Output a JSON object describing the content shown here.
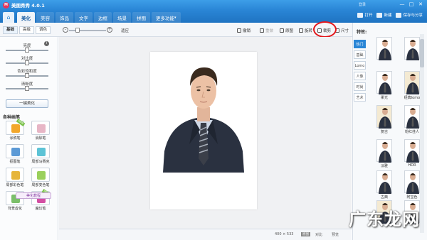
{
  "window": {
    "title": "美图秀秀 4.0.1",
    "login": "登录",
    "controls": [
      "—",
      "□",
      "✕"
    ]
  },
  "menu": {
    "tabs": [
      "美化",
      "美容",
      "饰品",
      "文字",
      "边框",
      "场景",
      "拼图",
      "更多功能"
    ],
    "active_index": 0,
    "right_actions": [
      "打开",
      "新建",
      "保存与分享"
    ]
  },
  "toolbar": {
    "subtabs": [
      "基础",
      "高级",
      "调色"
    ],
    "zoom_fit": "适应",
    "buttons": [
      "撤销",
      "重做",
      "原图",
      "旋转",
      "裁剪",
      "尺寸"
    ]
  },
  "left_panel": {
    "sliders": [
      {
        "label": "亮度",
        "value": 0.45
      },
      {
        "label": "对比度",
        "value": 0.45
      },
      {
        "label": "色彩饱和度",
        "value": 0.45
      },
      {
        "label": "清晰度",
        "value": 0.45
      }
    ],
    "one_key_button": "一键美化",
    "brushes_title": "各种画笔",
    "brushes": [
      {
        "label": "涂鸦笔",
        "icon": "pencil-icon",
        "badge": "NEW"
      },
      {
        "label": "消除笔",
        "icon": "eraser-icon",
        "badge": ""
      },
      {
        "label": "抠图笔",
        "icon": "scissors-icon",
        "badge": ""
      },
      {
        "label": "局部马赛克",
        "icon": "mosaic-icon",
        "badge": ""
      },
      {
        "label": "局部彩色笔",
        "icon": "color-pen-icon",
        "badge": ""
      },
      {
        "label": "局部变色笔",
        "icon": "recolor-pen-icon",
        "badge": ""
      },
      {
        "label": "背景虚化",
        "icon": "blur-icon",
        "badge": ""
      },
      {
        "label": "魔幻笔",
        "icon": "magic-pen-icon",
        "badge": "NEW"
      }
    ],
    "beauty_button": "美化教程"
  },
  "status": {
    "dimensions": "400 × 533",
    "chip": "原图",
    "compare": "对比",
    "preview": "预览"
  },
  "effects": {
    "title": "特效:",
    "tabs": [
      "热门",
      "基础",
      "Lomo",
      "人像",
      "时尚",
      "艺术"
    ],
    "active_tab": 0,
    "thumbs": [
      {
        "label": "",
        "warm": false
      },
      {
        "label": "",
        "warm": false
      },
      {
        "label": "柔光",
        "warm": false
      },
      {
        "label": "经典lomo",
        "warm": true
      },
      {
        "label": "复古",
        "warm": true
      },
      {
        "label": "粉红佳人",
        "warm": false
      },
      {
        "label": "淡雅",
        "warm": false
      },
      {
        "label": "HDR",
        "warm": false
      },
      {
        "label": "古典",
        "warm": false
      },
      {
        "label": "阿宝色",
        "warm": false
      },
      {
        "label": "",
        "warm": true
      },
      {
        "label": "",
        "warm": false
      }
    ]
  },
  "watermark": "广东龙网",
  "colors": {
    "titlebar": "#3d9ee8",
    "accent": "#2a86d6",
    "highlight": "#e3151a"
  }
}
